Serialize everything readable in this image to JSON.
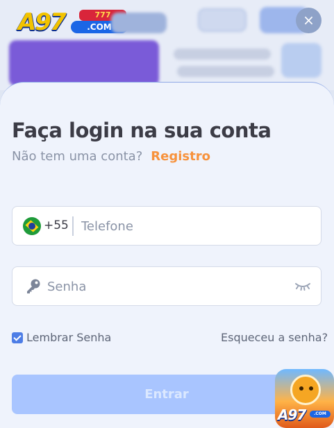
{
  "brand": {
    "logo_text": "A97",
    "logo_domain": ".COM",
    "logo_badge": "777"
  },
  "dialog": {
    "title": "Faça login na sua conta",
    "no_account_text": "Não tem uma conta?",
    "register_link": "Registro",
    "close_icon": "×"
  },
  "phone": {
    "flag_icon": "brazil-flag-icon",
    "country_code": "+55",
    "placeholder": "Telefone",
    "value": ""
  },
  "password": {
    "lock_icon": "key-icon",
    "placeholder": "Senha",
    "value": "",
    "toggle_icon": "eye-closed-icon"
  },
  "remember": {
    "label": "Lembrar Senha",
    "checked": true
  },
  "forgot_link": "Esqueceu a senha?",
  "submit_label": "Entrar",
  "app_icon": {
    "logo_text": "A97",
    "logo_domain": ".COM"
  },
  "colors": {
    "accent": "#f7923c",
    "primary": "#4d7de6",
    "button_disabled": "#a9c5ff",
    "sheet": "#eff3fc"
  }
}
